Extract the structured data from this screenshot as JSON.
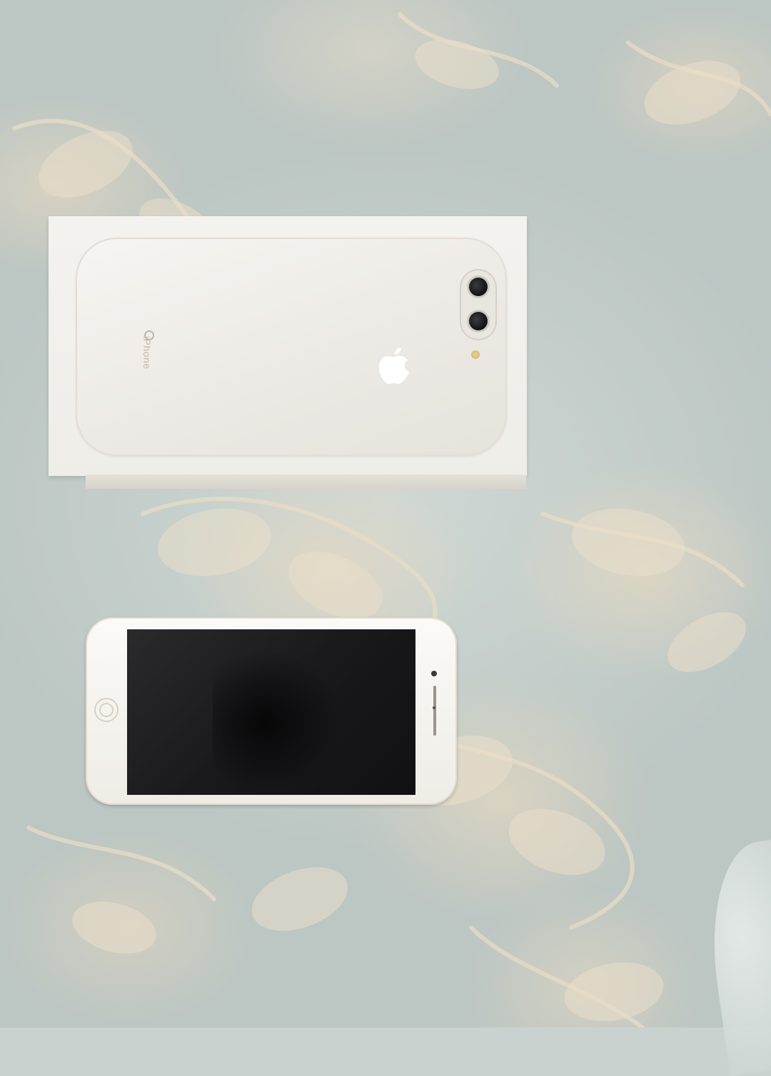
{
  "scene": {
    "description_text": "",
    "colors": {
      "fabric": "#c9d2cf",
      "floral_pattern": "#e2d6c0",
      "box": "#f1efea",
      "phone_body": "#f7f5f1",
      "screen": "#1b1b1d",
      "camera_flash": "#e0c987"
    }
  },
  "box": {
    "brand_text": "iPhone",
    "icons": [
      "apple-logo-icon",
      "camera-lens-icon",
      "flash-icon"
    ]
  },
  "phone": {
    "icons": [
      "home-button-icon",
      "front-camera-icon",
      "speaker-icon"
    ]
  }
}
